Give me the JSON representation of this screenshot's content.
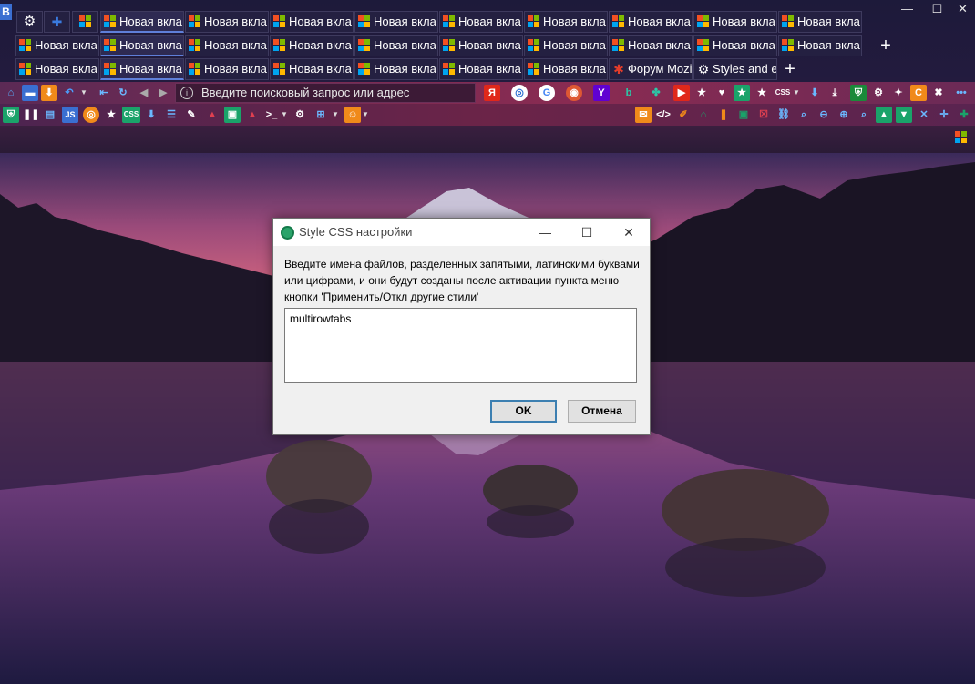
{
  "browser": {
    "app_badge": "B",
    "window_controls": {
      "minimize": "—",
      "maximize": "☐",
      "close": "✕"
    }
  },
  "tabs": {
    "new_tab_label": "Новая вкла",
    "special_tabs": {
      "forum": "Форум Mozi",
      "styles": "Styles and e"
    },
    "new_tab_button": "+"
  },
  "navbar": {
    "url_placeholder": "Введите поисковый запрос или адрес",
    "info_icon": "i"
  },
  "dialog": {
    "title": "Style CSS настройки",
    "message": "Введите имена файлов, разделенных запятыми, латинскими буквами или цифрами, и они будут созданы после активации пункта меню кнопки 'Применить/Откл другие стили'",
    "input_value": "multirowtabs",
    "ok_label": "OK",
    "cancel_label": "Отмена",
    "wctl": {
      "minimize": "—",
      "maximize": "☐",
      "close": "✕"
    }
  },
  "toolbar_labels": {
    "css": "CSS",
    "js": "JS",
    "yandex": "Я",
    "google": "G",
    "yahoo": "Y",
    "bing": "b"
  },
  "colors": {
    "accent": "#5f7fd9",
    "navbar": "#7d2b52",
    "dialog_bg": "#f0f0f0"
  }
}
